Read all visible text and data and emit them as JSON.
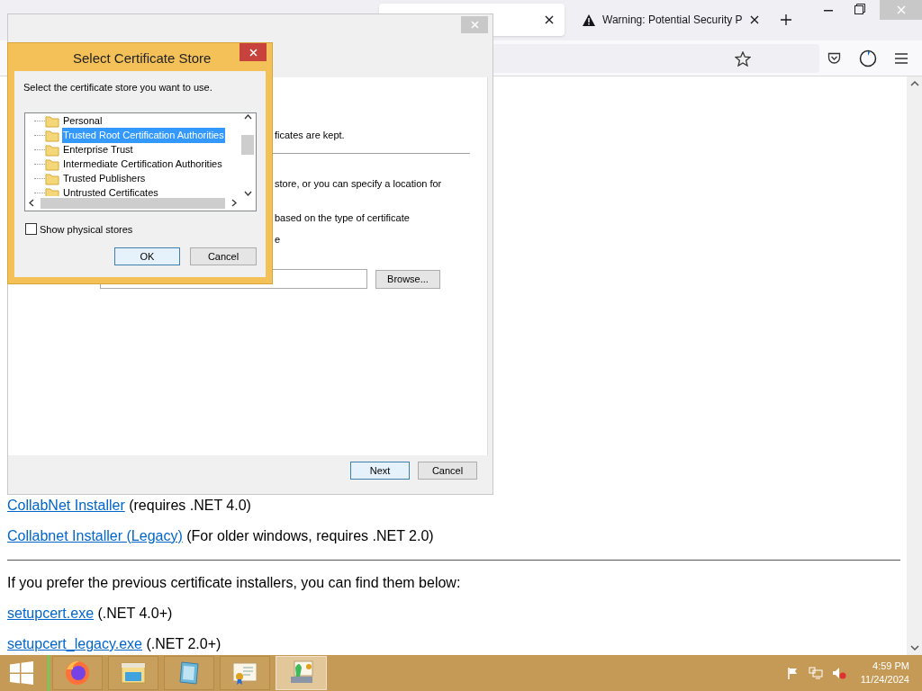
{
  "browser": {
    "tabs": [
      {
        "selected": true
      },
      {
        "title": "Warning: Potential Security P",
        "selected": false
      }
    ]
  },
  "page": {
    "blocks": [
      {
        "kind": "link_line",
        "link": "CollabNet Installer",
        "note": " (requires .NET 4.0)"
      },
      {
        "kind": "link_line",
        "link": "Collabnet Installer (Legacy)",
        "note": " (For older windows, requires .NET 2.0)"
      },
      {
        "kind": "rule"
      },
      {
        "kind": "text",
        "text": "If you prefer the previous certificate installers, you can find them below:"
      },
      {
        "kind": "link_line",
        "link": "setupcert.exe",
        "note": " (.NET 4.0+)"
      },
      {
        "kind": "link_line",
        "link": "setupcert_legacy.exe",
        "note": " (.NET 2.0+)"
      }
    ]
  },
  "wizard": {
    "fragments": [
      "ficates are kept.",
      "store, or you can specify a location for",
      "based on the type of certificate",
      "e"
    ],
    "browse_button": "Browse...",
    "buttons": [
      "Next",
      "Cancel"
    ]
  },
  "dialog": {
    "title": "Select Certificate Store",
    "prompt": "Select the certificate store you want to use.",
    "stores": [
      {
        "label": "Personal",
        "selected": false
      },
      {
        "label": "Trusted Root Certification Authorities",
        "selected": true
      },
      {
        "label": "Enterprise Trust",
        "selected": false
      },
      {
        "label": "Intermediate Certification Authorities",
        "selected": false
      },
      {
        "label": "Trusted Publishers",
        "selected": false
      },
      {
        "label": "Untrusted Certificates",
        "selected": false
      }
    ],
    "show_physical_stores": {
      "label": "Show physical stores",
      "checked": false
    },
    "buttons": [
      "OK",
      "Cancel"
    ]
  },
  "taskbar": {
    "apps": [
      {
        "kind": "firefox",
        "active": false
      },
      {
        "kind": "explorer",
        "active": false
      },
      {
        "kind": "notepad",
        "active": false
      },
      {
        "kind": "certificate",
        "active": false
      },
      {
        "kind": "installer",
        "active": true
      }
    ],
    "time": "4:59 PM",
    "date": "11/24/2024"
  }
}
